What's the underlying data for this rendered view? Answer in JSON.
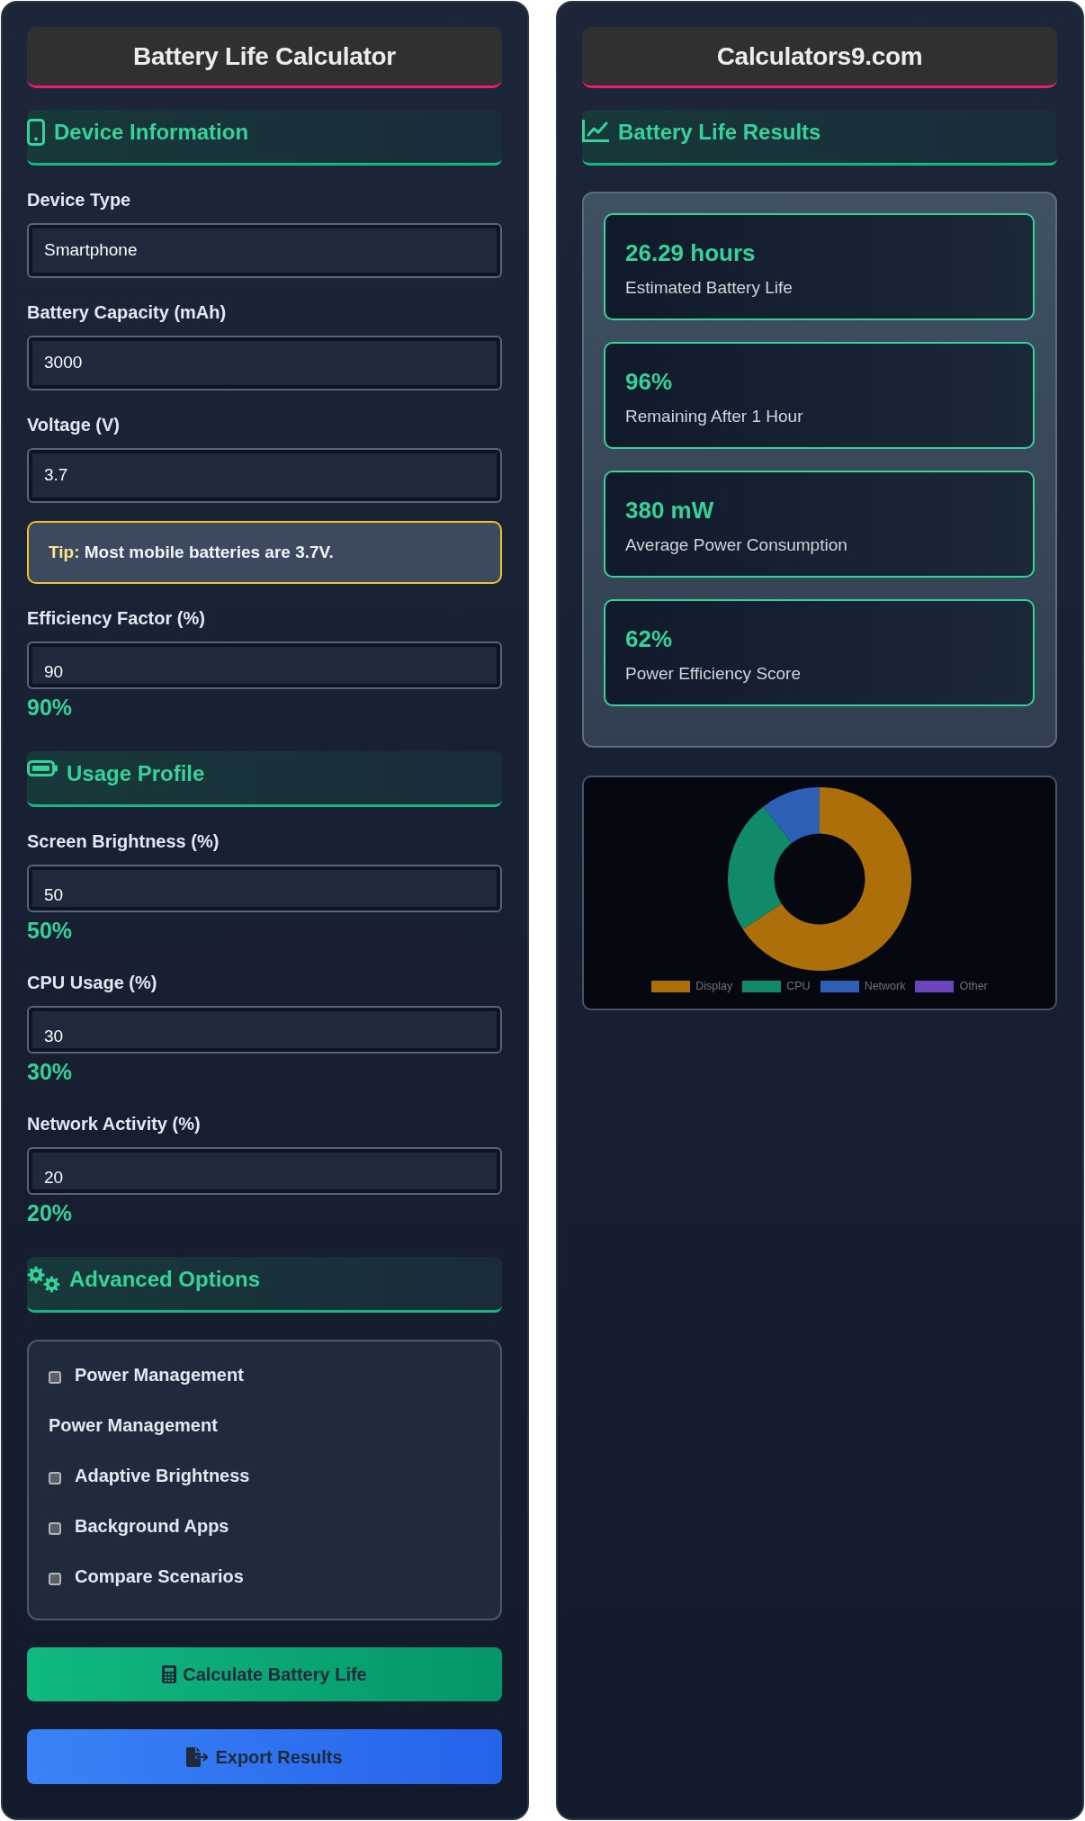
{
  "calculator": {
    "title": "Battery Life Calculator",
    "sections": [
      {
        "heading": "Device Information",
        "items": [
          {
            "kind": "field",
            "label": "Device Type",
            "value": "Smartphone"
          },
          {
            "kind": "field",
            "label": "Battery Capacity (mAh)",
            "value": "3000"
          },
          {
            "kind": "field",
            "label": "Voltage (V)",
            "value": "3.7"
          },
          {
            "kind": "tip",
            "text": "**Tip:** Most mobile batteries are 3.7V."
          },
          {
            "kind": "range",
            "label": "Efficiency Factor (%)",
            "value": "90",
            "reading": "90%"
          }
        ]
      },
      {
        "heading": "Usage Profile",
        "items": [
          {
            "kind": "range",
            "label": "Screen Brightness (%)",
            "value": "50",
            "reading": "50%"
          },
          {
            "kind": "range",
            "label": "CPU Usage (%)",
            "value": "30",
            "reading": "30%"
          },
          {
            "kind": "range",
            "label": "Network Activity (%)",
            "value": "20",
            "reading": "20%"
          }
        ]
      },
      {
        "heading": "Advanced Options",
        "items": [
          {
            "kind": "options",
            "entries": [
              {
                "kind": "checkbox",
                "label": "Power Management",
                "checked": false
              },
              {
                "kind": "heading",
                "label": "Power Management"
              },
              {
                "kind": "checkbox",
                "label": "Adaptive Brightness",
                "checked": false
              },
              {
                "kind": "checkbox",
                "label": "Background Apps",
                "checked": false
              },
              {
                "kind": "checkbox",
                "label": "Compare Scenarios",
                "checked": false
              }
            ]
          }
        ]
      }
    ],
    "buttons": [
      {
        "kind": "calculate",
        "label": "Calculate Battery Life"
      },
      {
        "kind": "export",
        "label": "Export Results"
      }
    ]
  },
  "results": {
    "title": "Calculators9.com",
    "heading": "Battery Life Results",
    "cards": [
      {
        "value": "26.29 hours",
        "label": "Estimated Battery Life"
      },
      {
        "value": "96%",
        "label": "Remaining After 1 Hour"
      },
      {
        "value": "380 mW",
        "label": "Average Power Consumption"
      },
      {
        "value": "62%",
        "label": "Power Efficiency Score"
      }
    ],
    "chart": {
      "legend": [
        {
          "label": "Display",
          "color": "#ad6f0a"
        },
        {
          "label": "CPU",
          "color": "#108a68"
        },
        {
          "label": "Network",
          "color": "#2d5fb4"
        },
        {
          "label": "Other",
          "color": "#6a45bb"
        }
      ]
    }
  }
}
